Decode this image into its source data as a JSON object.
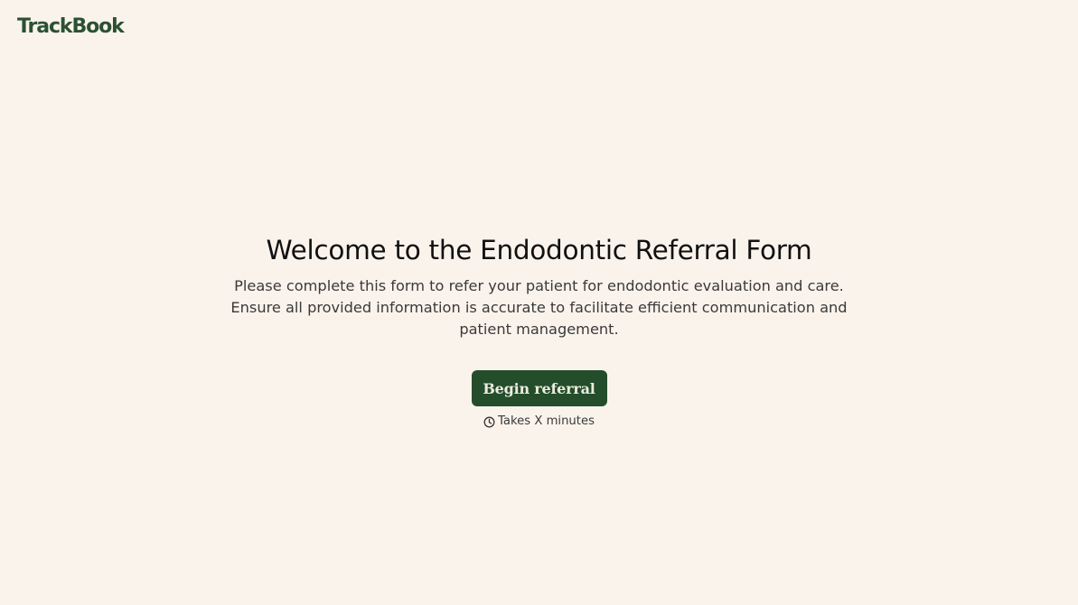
{
  "header": {
    "logo_text": "TrackBook"
  },
  "welcome": {
    "title": "Welcome to the Endodontic Referral Form",
    "description": "Please complete this form to refer your patient for endodontic evaluation and care. Ensure all provided information is accurate to facilitate efficient communication and patient management.",
    "begin_button_label": "Begin referral",
    "duration_icon": "clock-icon",
    "duration_text": "Takes X minutes"
  },
  "colors": {
    "background": "#faf3ec",
    "brand_green": "#2b5132",
    "button_bg": "#244d2b",
    "button_text": "#ecece0"
  }
}
